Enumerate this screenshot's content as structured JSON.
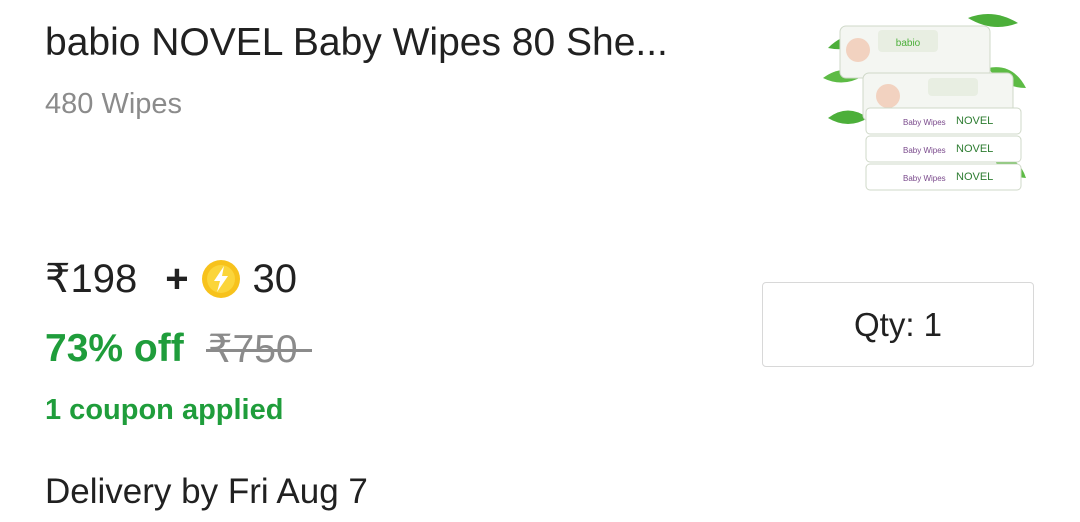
{
  "product": {
    "title": "babio NOVEL Baby Wipes 80 She...",
    "variant": "480 Wipes",
    "image_brand_text": "NOVEL",
    "image_pack_label": "Baby Wipes"
  },
  "pricing": {
    "price": "₹198",
    "plus": "+",
    "coins": "30",
    "discount": "73% off",
    "mrp": "₹750",
    "coupon_text": "1 coupon applied",
    "colors": {
      "discount": "#1f9d3b",
      "mrp": "#8b8b8b",
      "coin": "#f7c21c"
    }
  },
  "quantity": {
    "label": "Qty: 1"
  },
  "delivery": {
    "text": "Delivery by Fri Aug 7"
  }
}
